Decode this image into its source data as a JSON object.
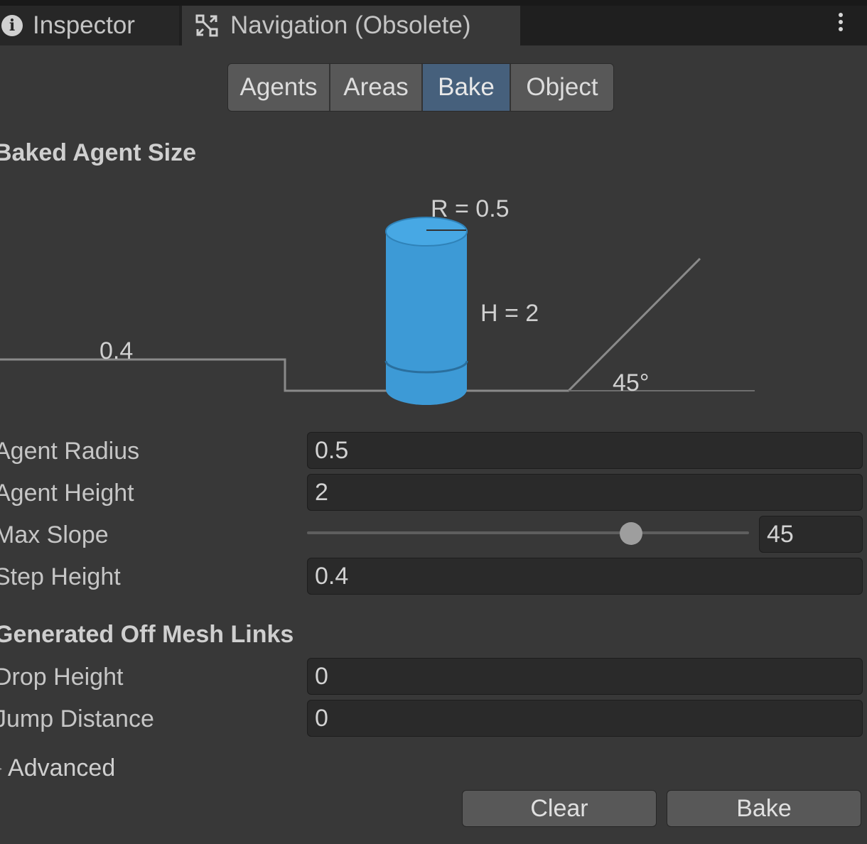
{
  "tabs": {
    "inspector": "Inspector",
    "navigation": "Navigation (Obsolete)"
  },
  "segments": {
    "agents": "Agents",
    "areas": "Areas",
    "bake": "Bake",
    "object": "Object",
    "active": "Bake"
  },
  "baked_agent_size": {
    "title": "Baked Agent Size",
    "diagram": {
      "radius_label": "R = 0.5",
      "height_label": "H = 2",
      "step_label": "0.4",
      "slope_label": "45°",
      "cylinder_color": "#3d9ad6"
    }
  },
  "fields": {
    "agent_radius": {
      "label": "Agent Radius",
      "value": "0.5"
    },
    "agent_height": {
      "label": "Agent Height",
      "value": "2"
    },
    "max_slope": {
      "label": "Max Slope",
      "value": "45",
      "fraction": 0.733
    },
    "step_height": {
      "label": "Step Height",
      "value": "0.4"
    }
  },
  "off_mesh": {
    "title": "Generated Off Mesh Links",
    "drop_height": {
      "label": "Drop Height",
      "value": "0"
    },
    "jump_distance": {
      "label": "Jump Distance",
      "value": "0"
    }
  },
  "advanced": {
    "label": "Advanced",
    "arrow": "▸"
  },
  "buttons": {
    "clear": "Clear",
    "bake": "Bake"
  },
  "colors": {
    "background": "#383838",
    "accent_tab": "#46607c"
  }
}
